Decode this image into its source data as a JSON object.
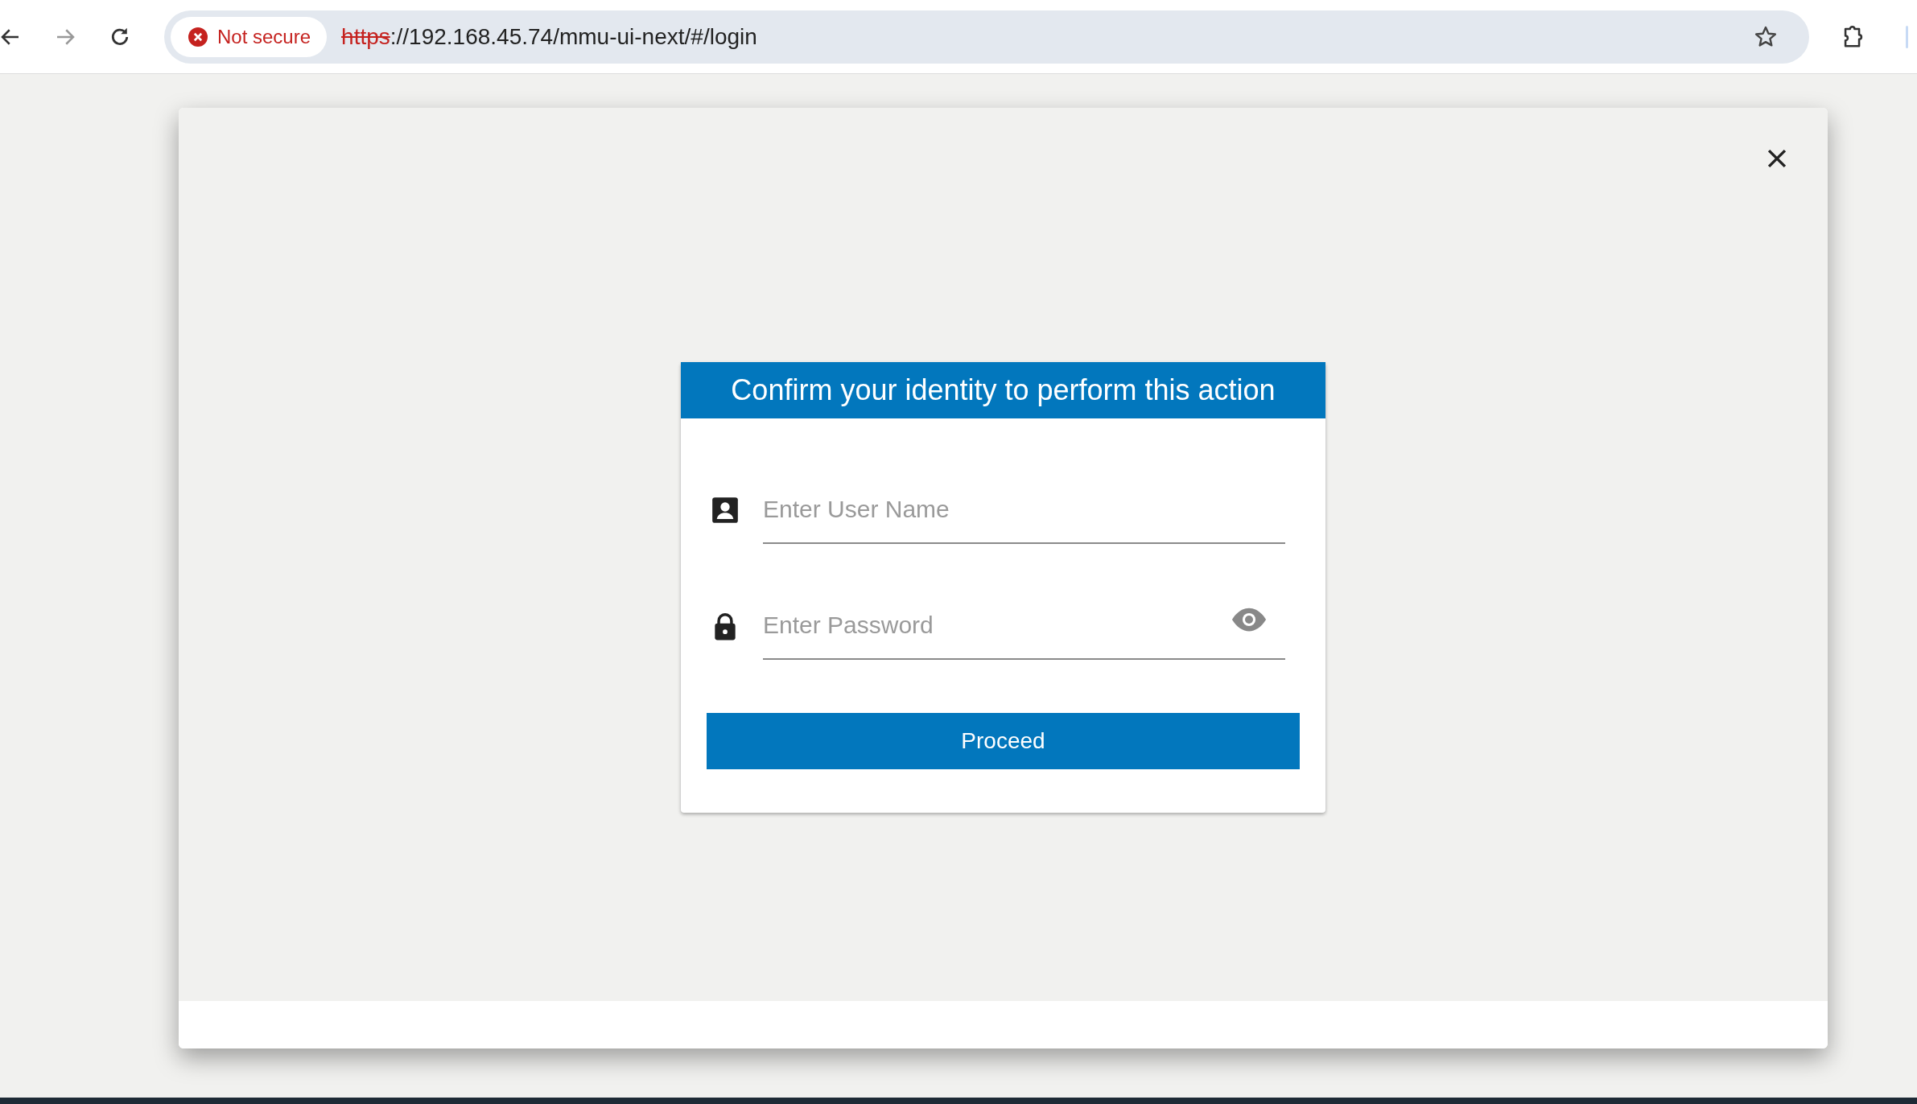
{
  "browser": {
    "security_label": "Not secure",
    "url_scheme": "https",
    "url_rest": "://192.168.45.74/mmu-ui-next/#/login"
  },
  "dialog": {
    "title": "Confirm your identity to perform this action",
    "fields": [
      {
        "kind": "user",
        "placeholder": "Enter User Name"
      },
      {
        "kind": "password",
        "placeholder": "Enter Password"
      }
    ],
    "button": "Proceed"
  }
}
